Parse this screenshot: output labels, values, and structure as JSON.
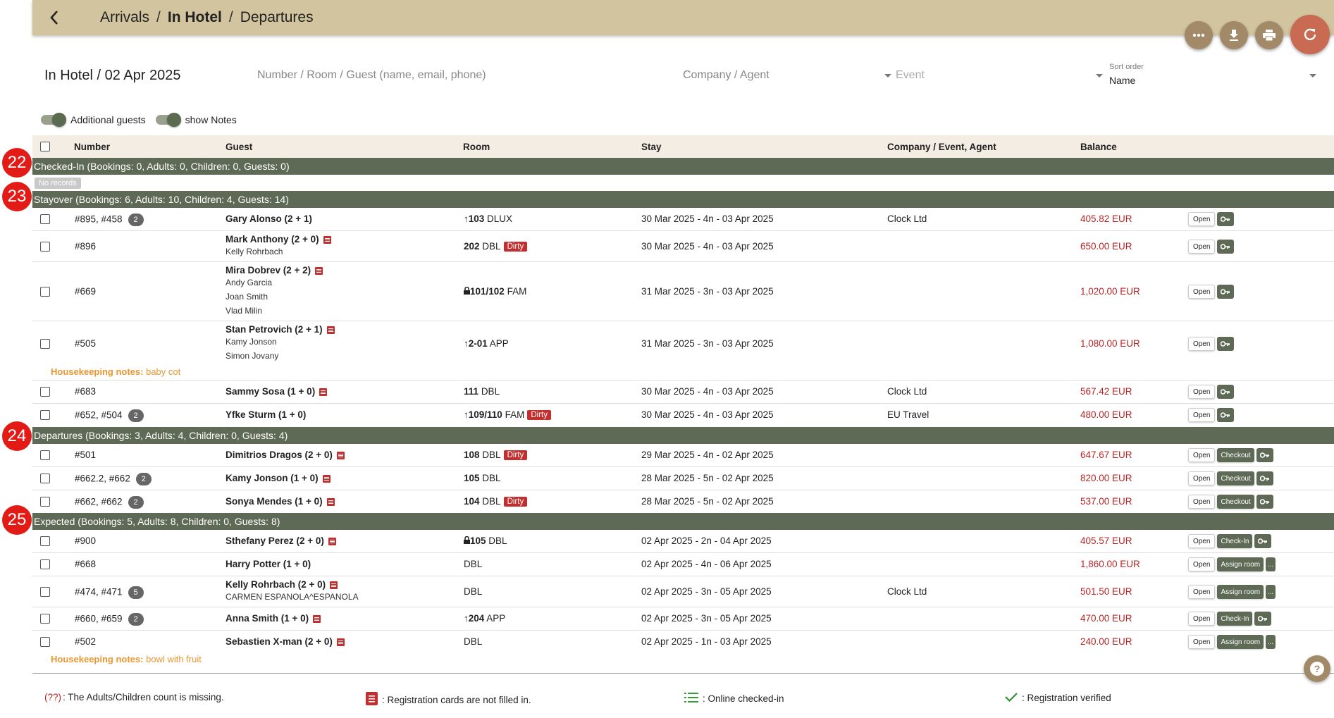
{
  "breadcrumb": {
    "a": "Arrivals",
    "b": "In Hotel",
    "c": "Departures",
    "sep": "/"
  },
  "filters": {
    "title": "In Hotel / 02 Apr 2025",
    "search_placeholder": "Number / Room / Guest (name, email, phone)",
    "company_placeholder": "Company / Agent",
    "event_placeholder": "Event",
    "sort_label": "Sort order",
    "sort_value": "Name"
  },
  "toggles": {
    "additional": "Additional guests",
    "notes": "show Notes"
  },
  "columns": {
    "number": "Number",
    "guest": "Guest",
    "room": "Room",
    "stay": "Stay",
    "company": "Company / Event, Agent",
    "balance": "Balance"
  },
  "markers": [
    "22",
    "23",
    "24",
    "25"
  ],
  "buttons": {
    "open": "Open",
    "checkout": "Checkout",
    "checkin": "Check-In",
    "assign": "Assign room",
    "more": "..."
  },
  "dirty_label": "Dirty",
  "sections": {
    "checked_in": {
      "title": "Checked-In (Bookings: 0, Adults: 0, Children: 0, Guests: 0)",
      "no_records": "No records"
    },
    "stayover": {
      "title": "Stayover (Bookings: 6, Adults: 10, Children: 4, Guests: 14)",
      "rows": [
        {
          "number": "#895, #458",
          "badge": "2",
          "guest": "Gary Alonso (2 + 1)",
          "room_num": "103",
          "room_type": "DLUX",
          "stay": "30 Mar 2025 - 4n - 03 Apr 2025",
          "company": "Clock Ltd",
          "balance": "405.82 EUR"
        },
        {
          "number": "#896",
          "guest": "Mark Anthony (2 + 0)",
          "sub1": "Kelly Rohrbach",
          "room_num": "202",
          "room_type": "DBL",
          "stay": "30 Mar 2025 - 4n - 03 Apr 2025",
          "company": "",
          "balance": "650.00 EUR"
        },
        {
          "number": "#669",
          "guest": "Mira Dobrev (2 + 2)",
          "sub1": "Andy Garcia",
          "sub2": "Joan Smith",
          "sub3": "Vlad Milin",
          "room_num": "101/102",
          "room_type": "FAM",
          "stay": "31 Mar 2025 - 3n - 03 Apr 2025",
          "company": "",
          "balance": "1,020.00 EUR"
        },
        {
          "number": "#505",
          "guest": "Stan Petrovich (2 + 1)",
          "sub1": "Kamy Jonson",
          "sub2": "Simon Jovany",
          "room_num": "2-01",
          "room_type": "APP",
          "stay": "31 Mar 2025 - 3n - 03 Apr 2025",
          "company": "",
          "balance": "1,080.00 EUR",
          "hk_label": "Housekeeping notes:",
          "hk_text": "baby cot"
        },
        {
          "number": "#683",
          "guest": "Sammy Sosa (1 + 0)",
          "room_num": "111",
          "room_type": "DBL",
          "stay": "30 Mar 2025 - 4n - 03 Apr 2025",
          "company": "Clock Ltd",
          "balance": "567.42 EUR"
        },
        {
          "number": "#652, #504",
          "badge": "2",
          "guest": "Yfke Sturm (1 + 0)",
          "room_num": "109/110",
          "room_type": "FAM",
          "stay": "30 Mar 2025 - 4n - 03 Apr 2025",
          "company": "EU Travel",
          "balance": "480.00 EUR"
        }
      ]
    },
    "departures": {
      "title": "Departures (Bookings: 3, Adults: 4, Children: 0, Guests: 4)",
      "rows": [
        {
          "number": "#501",
          "guest": "Dimitrios Dragos (2 + 0)",
          "room_num": "108",
          "room_type": "DBL",
          "stay": "29 Mar 2025 - 4n - 02 Apr 2025",
          "balance": "647.67 EUR"
        },
        {
          "number": "#662.2, #662",
          "badge": "2",
          "guest": "Kamy Jonson (1 + 0)",
          "room_num": "105",
          "room_type": "DBL",
          "stay": "28 Mar 2025 - 5n - 02 Apr 2025",
          "balance": "820.00 EUR"
        },
        {
          "number": "#662, #662",
          "badge": "2",
          "guest": "Sonya Mendes (1 + 0)",
          "room_num": "104",
          "room_type": "DBL",
          "stay": "28 Mar 2025 - 5n - 02 Apr 2025",
          "balance": "537.00 EUR"
        }
      ]
    },
    "expected": {
      "title": "Expected (Bookings: 5, Adults: 8, Children: 0, Guests: 8)",
      "rows": [
        {
          "number": "#900",
          "guest": "Sthefany Perez (2 + 0)",
          "room_num": "105",
          "room_type": "DBL",
          "stay": "02 Apr 2025 - 2n - 04 Apr 2025",
          "company": "",
          "balance": "405.57 EUR"
        },
        {
          "number": "#668",
          "guest": "Harry Potter (1 + 0)",
          "room_type": "DBL",
          "stay": "02 Apr 2025 - 4n - 06 Apr 2025",
          "company": "",
          "balance": "1,860.00 EUR"
        },
        {
          "number": "#474, #471",
          "badge": "5",
          "guest": "Kelly Rohrbach (2 + 0)",
          "sub1": "CARMEN ESPANOLA^ESPANOLA",
          "room_type": "DBL",
          "stay": "02 Apr 2025 - 3n - 05 Apr 2025",
          "company": "Clock Ltd",
          "balance": "501.50 EUR"
        },
        {
          "number": "#660, #659",
          "badge": "2",
          "guest": "Anna Smith (1 + 0)",
          "room_num": "204",
          "room_type": "APP",
          "stay": "02 Apr 2025 - 3n - 05 Apr 2025",
          "company": "",
          "balance": "470.00 EUR"
        },
        {
          "number": "#502",
          "guest": "Sebastien X-man (2 + 0)",
          "room_type": "DBL",
          "stay": "02 Apr 2025 - 1n - 03 Apr 2025",
          "company": "",
          "balance": "240.00 EUR",
          "hk_label": "Housekeeping notes:",
          "hk_text": "bowl with fruit"
        }
      ]
    }
  },
  "legend": {
    "missing_mark": "(??)",
    "missing_text": ": The Adults/Children count is missing.",
    "regcard_text": ": Registration cards are not filled in.",
    "online_text": ": Online checked-in",
    "verified_text": ": Registration verified"
  },
  "colors": {
    "topbar": "#d3c4a0",
    "section": "#5f6a56",
    "balance": "#b72626",
    "dirty": "#c32f2f",
    "marker": "#e31b17",
    "notes": "#e9962f"
  }
}
